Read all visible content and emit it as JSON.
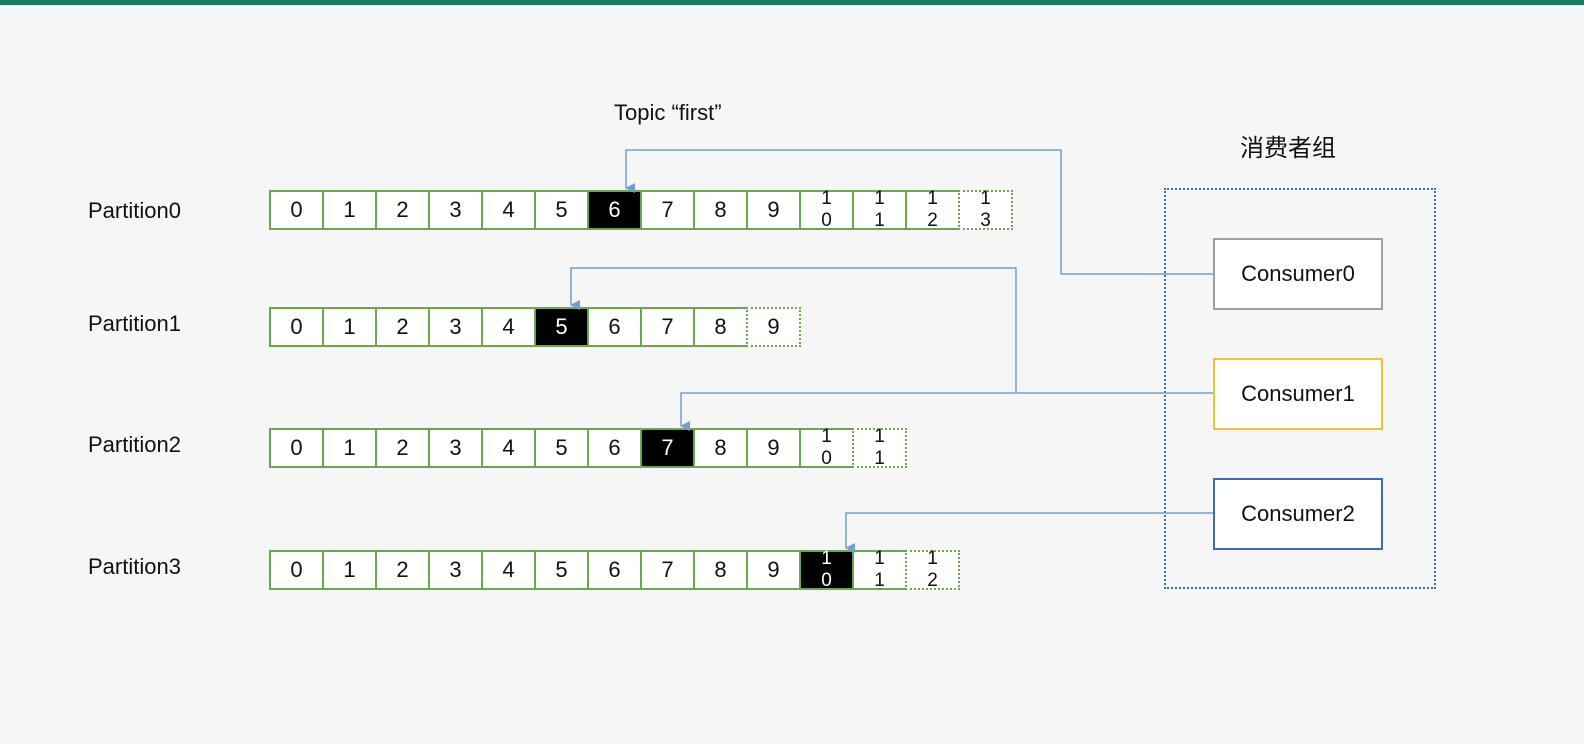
{
  "title": "Topic “first”",
  "group_label": "消费者组",
  "partitions": [
    {
      "label": "Partition0",
      "cells": [
        "0",
        "1",
        "2",
        "3",
        "4",
        "5",
        "6",
        "7",
        "8",
        "9",
        "10",
        "11",
        "12",
        "13"
      ],
      "current": 6,
      "pending": 13
    },
    {
      "label": "Partition1",
      "cells": [
        "0",
        "1",
        "2",
        "3",
        "4",
        "5",
        "6",
        "7",
        "8",
        "9"
      ],
      "current": 5,
      "pending": 9
    },
    {
      "label": "Partition2",
      "cells": [
        "0",
        "1",
        "2",
        "3",
        "4",
        "5",
        "6",
        "7",
        "8",
        "9",
        "10",
        "11"
      ],
      "current": 7,
      "pending": 11
    },
    {
      "label": "Partition3",
      "cells": [
        "0",
        "1",
        "2",
        "3",
        "4",
        "5",
        "6",
        "7",
        "8",
        "9",
        "10",
        "11",
        "12"
      ],
      "current": 10,
      "pending": 12
    }
  ],
  "consumers": [
    {
      "label": "Consumer0",
      "border_color": "#9e9e9e"
    },
    {
      "label": "Consumer1",
      "border_color": "#f1c232"
    },
    {
      "label": "Consumer2",
      "border_color": "#3d6bb3"
    }
  ],
  "colors": {
    "cell_border": "#6aa84f",
    "arrow": "#6fa0d4",
    "group_border": "#3e6fa6"
  }
}
